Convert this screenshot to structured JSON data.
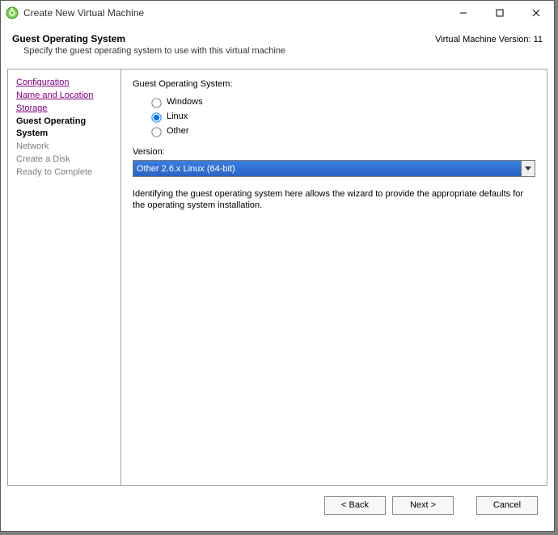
{
  "window": {
    "title": "Create New Virtual Machine"
  },
  "header": {
    "title": "Guest Operating System",
    "subtitle": "Specify the guest operating system to use with this virtual machine",
    "version_label": "Virtual Machine Version: 11"
  },
  "sidebar": {
    "steps": [
      {
        "label": "Configuration",
        "state": "visited"
      },
      {
        "label": "Name and Location",
        "state": "visited"
      },
      {
        "label": "Storage",
        "state": "visited"
      },
      {
        "label": "Guest Operating System",
        "state": "current"
      },
      {
        "label": "Network",
        "state": "disabled"
      },
      {
        "label": "Create a Disk",
        "state": "disabled"
      },
      {
        "label": "Ready to Complete",
        "state": "disabled"
      }
    ]
  },
  "main": {
    "os_group_label": "Guest Operating System:",
    "os_options": {
      "windows": "Windows",
      "linux": "Linux",
      "other": "Other"
    },
    "os_selected": "linux",
    "version_label": "Version:",
    "version_selected": "Other 2.6.x Linux (64-bit)",
    "help_text": "Identifying the guest operating system here allows the wizard to provide the appropriate defaults for the operating system installation."
  },
  "footer": {
    "back": "< Back",
    "next": "Next >",
    "cancel": "Cancel"
  }
}
